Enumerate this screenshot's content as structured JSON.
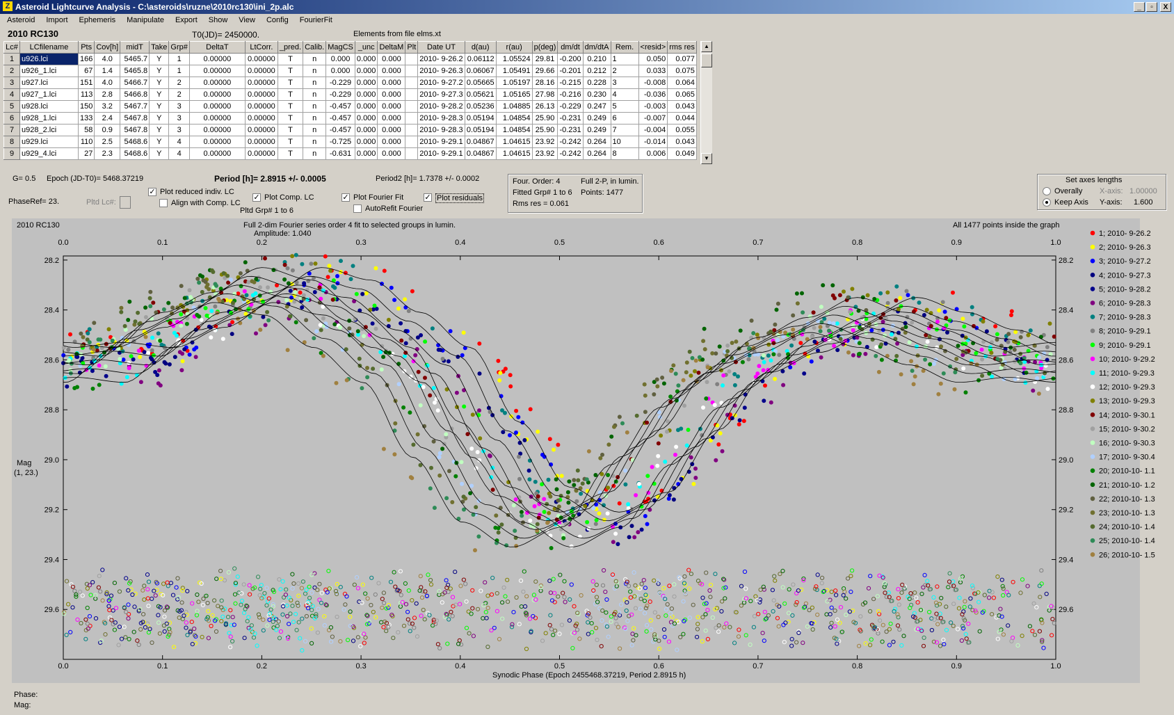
{
  "window": {
    "title": "Asteroid Lightcurve Analysis - C:\\asteroids\\ruzne\\2010rc130\\ini_2p.alc",
    "icon": "app-icon",
    "controls": [
      "_",
      "▫",
      "X"
    ]
  },
  "menu": [
    "Asteroid",
    "Import",
    "Ephemeris",
    "Manipulate",
    "Export",
    "Show",
    "View",
    "Config",
    "FourierFit"
  ],
  "header": {
    "asteroid": "2010 RC130",
    "t0": "T0(JD)= 2450000.",
    "elements": "Elements from file elms.xt"
  },
  "table": {
    "columns": [
      "Lc#",
      "LCfilename",
      "Pts",
      "Cov[h]",
      "midT",
      "Take",
      "Grp#",
      "DeltaT",
      "LtCorr.",
      "_pred.",
      "Calib.",
      "MagCS",
      "_unc",
      "DeltaM",
      "Plt",
      "Date UT",
      "d(au)",
      "r(au)",
      "p(deg)",
      "dm/dt",
      "dm/dtA",
      "Rem.",
      "<resid>",
      "rms res"
    ],
    "rows": [
      [
        "1",
        "u926.lci",
        "166",
        "4.0",
        "5465.7",
        "Y",
        "1",
        "0.00000",
        "0.00000",
        "T",
        "n",
        "0.000",
        "0.000",
        "0.000",
        "",
        "2010- 9-26.2",
        "0.06112",
        "1.05524",
        "29.81",
        "-0.200",
        "0.210",
        "1",
        "0.050",
        "0.077"
      ],
      [
        "2",
        "u926_1.lci",
        "67",
        "1.4",
        "5465.8",
        "Y",
        "1",
        "0.00000",
        "0.00000",
        "T",
        "n",
        "0.000",
        "0.000",
        "0.000",
        "",
        "2010- 9-26.3",
        "0.06067",
        "1.05491",
        "29.66",
        "-0.201",
        "0.212",
        "2",
        "0.033",
        "0.075"
      ],
      [
        "3",
        "u927.lci",
        "151",
        "4.0",
        "5466.7",
        "Y",
        "2",
        "0.00000",
        "0.00000",
        "T",
        "n",
        "-0.229",
        "0.000",
        "0.000",
        "",
        "2010- 9-27.2",
        "0.05665",
        "1.05197",
        "28.16",
        "-0.215",
        "0.228",
        "3",
        "-0.008",
        "0.064"
      ],
      [
        "4",
        "u927_1.lci",
        "113",
        "2.8",
        "5466.8",
        "Y",
        "2",
        "0.00000",
        "0.00000",
        "T",
        "n",
        "-0.229",
        "0.000",
        "0.000",
        "",
        "2010- 9-27.3",
        "0.05621",
        "1.05165",
        "27.98",
        "-0.216",
        "0.230",
        "4",
        "-0.036",
        "0.065"
      ],
      [
        "5",
        "u928.lci",
        "150",
        "3.2",
        "5467.7",
        "Y",
        "3",
        "0.00000",
        "0.00000",
        "T",
        "n",
        "-0.457",
        "0.000",
        "0.000",
        "",
        "2010- 9-28.2",
        "0.05236",
        "1.04885",
        "26.13",
        "-0.229",
        "0.247",
        "5",
        "-0.003",
        "0.043"
      ],
      [
        "6",
        "u928_1.lci",
        "133",
        "2.4",
        "5467.8",
        "Y",
        "3",
        "0.00000",
        "0.00000",
        "T",
        "n",
        "-0.457",
        "0.000",
        "0.000",
        "",
        "2010- 9-28.3",
        "0.05194",
        "1.04854",
        "25.90",
        "-0.231",
        "0.249",
        "6",
        "-0.007",
        "0.044"
      ],
      [
        "7",
        "u928_2.lci",
        "58",
        "0.9",
        "5467.8",
        "Y",
        "3",
        "0.00000",
        "0.00000",
        "T",
        "n",
        "-0.457",
        "0.000",
        "0.000",
        "",
        "2010- 9-28.3",
        "0.05194",
        "1.04854",
        "25.90",
        "-0.231",
        "0.249",
        "7",
        "-0.004",
        "0.055"
      ],
      [
        "8",
        "u929.lci",
        "110",
        "2.5",
        "5468.6",
        "Y",
        "4",
        "0.00000",
        "0.00000",
        "T",
        "n",
        "-0.725",
        "0.000",
        "0.000",
        "",
        "2010- 9-29.1",
        "0.04867",
        "1.04615",
        "23.92",
        "-0.242",
        "0.264",
        "10",
        "-0.014",
        "0.043"
      ],
      [
        "9",
        "u929_4.lci",
        "27",
        "2.3",
        "5468.6",
        "Y",
        "4",
        "0.00000",
        "0.00000",
        "T",
        "n",
        "-0.631",
        "0.000",
        "0.000",
        "",
        "2010- 9-29.1",
        "0.04867",
        "1.04615",
        "23.92",
        "-0.242",
        "0.264",
        "8",
        "0.006",
        "0.049"
      ]
    ]
  },
  "controls": {
    "g": "G= 0.5",
    "epoch": "Epoch (JD-T0)= 5468.37219",
    "period": "Period [h]= 2.8915 +/- 0.0005",
    "period2": "Period2 [h]= 1.7378 +/- 0.0002",
    "phaseref": "PhaseRef= 23.",
    "pltd_lc": "Pltd Lc#:",
    "plot_reduced": "Plot reduced indiv. LC",
    "align_comp": "Align with Comp. LC",
    "plot_comp": "Plot Comp. LC",
    "pltd_grp": "Pltd Grp#  1   to   6",
    "plot_fourier": "Plot Fourier Fit",
    "autorefit": "AutoRefit Fourier",
    "plot_residuals": "Plot residuals"
  },
  "fourier_info": {
    "order": "Four. Order:  4",
    "mode": "Full 2-P, in lumin.",
    "fitted": "Fitted Grp# 1 to 6",
    "points": "Points: 1477",
    "rms": "Rms res     = 0.061"
  },
  "axes_box": {
    "title": "Set axes lengths",
    "overally": "Overally",
    "keep": "Keep Axis",
    "x_label": "X-axis:",
    "x_value": "1.00000",
    "y_label": "Y-axis:",
    "y_value": "1.600"
  },
  "footer": {
    "phase": "Phase:",
    "mag": "Mag:"
  },
  "chart_data": {
    "type": "scatter",
    "title_left": "2010 RC130",
    "title": "Full 2-dim Fourier series order 4 fit to selected groups in lumin.",
    "subtitle": "Amplitude: 1.040",
    "note": "All 1477 points inside the graph",
    "xlabel": "Synodic Phase (Epoch 2455468.37219, Period 2.8915 h)",
    "ylabel": "Mag",
    "ylabel2": "(1, 23.)",
    "xlim": [
      0.0,
      1.0
    ],
    "ylim": [
      28.1,
      29.8
    ],
    "y_inverted": true,
    "x_ticks": [
      "0.0",
      "0.1",
      "0.2",
      "0.3",
      "0.4",
      "0.5",
      "0.6",
      "0.7",
      "0.8",
      "0.9",
      "1.0"
    ],
    "y_ticks": [
      "28.2",
      "28.4",
      "28.6",
      "28.8",
      "29.0",
      "29.2",
      "29.4",
      "29.6"
    ],
    "fit_curve_phases": [
      0.0,
      0.05,
      0.1,
      0.15,
      0.2,
      0.25,
      0.3,
      0.35,
      0.4,
      0.45,
      0.5,
      0.55,
      0.6,
      0.65,
      0.7,
      0.75,
      0.8,
      0.85,
      0.9,
      0.95,
      1.0
    ],
    "fit_curve_mags": [
      28.6,
      28.62,
      28.48,
      28.4,
      28.3,
      28.35,
      28.48,
      28.62,
      28.92,
      29.18,
      29.28,
      29.2,
      28.95,
      28.72,
      28.58,
      28.5,
      28.42,
      28.48,
      28.55,
      28.62,
      28.6
    ],
    "residual_baseline": 29.6,
    "legend": [
      {
        "name": "1; 2010- 9-26.2",
        "color": "#ff0000"
      },
      {
        "name": "2; 2010- 9-26.3",
        "color": "#ffff00"
      },
      {
        "name": "3; 2010- 9-27.2",
        "color": "#0000ff"
      },
      {
        "name": "4; 2010- 9-27.3",
        "color": "#000080"
      },
      {
        "name": "5; 2010- 9-28.2",
        "color": "#00008b"
      },
      {
        "name": "6; 2010- 9-28.3",
        "color": "#800080"
      },
      {
        "name": "7; 2010- 9-28.3",
        "color": "#008080"
      },
      {
        "name": "8; 2010- 9-29.1",
        "color": "#808080"
      },
      {
        "name": "9; 2010- 9-29.1",
        "color": "#00ff00"
      },
      {
        "name": "10; 2010- 9-29.2",
        "color": "#ff00ff"
      },
      {
        "name": "11; 2010- 9-29.3",
        "color": "#00ffff"
      },
      {
        "name": "12; 2010- 9-29.3",
        "color": "#ffffff"
      },
      {
        "name": "13; 2010- 9-29.3",
        "color": "#808000"
      },
      {
        "name": "14; 2010- 9-30.1",
        "color": "#800000"
      },
      {
        "name": "15; 2010- 9-30.2",
        "color": "#a0a0a0"
      },
      {
        "name": "16; 2010- 9-30.3",
        "color": "#c0ffc0"
      },
      {
        "name": "17; 2010- 9-30.4",
        "color": "#b0d0ff"
      },
      {
        "name": "20; 2010-10- 1.1",
        "color": "#008000"
      },
      {
        "name": "21; 2010-10- 1.2",
        "color": "#006400"
      },
      {
        "name": "22; 2010-10- 1.3",
        "color": "#606040"
      },
      {
        "name": "23; 2010-10- 1.3",
        "color": "#707030"
      },
      {
        "name": "24; 2010-10- 1.4",
        "color": "#556b2f"
      },
      {
        "name": "25; 2010-10- 1.4",
        "color": "#2e8b57"
      },
      {
        "name": "26; 2010-10- 1.5",
        "color": "#a08040"
      }
    ]
  }
}
